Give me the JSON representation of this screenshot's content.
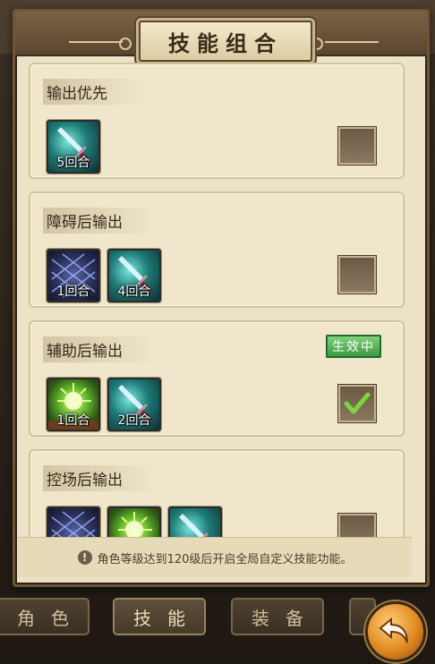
{
  "title": "技能组合",
  "combos": [
    {
      "title": "输出优先",
      "skills": [
        {
          "kind": "sword",
          "turns": "5回合"
        }
      ],
      "checked": false,
      "badge": ""
    },
    {
      "title": "障碍后输出",
      "skills": [
        {
          "kind": "net",
          "turns": "1回合"
        },
        {
          "kind": "sword",
          "turns": "4回合"
        }
      ],
      "checked": false,
      "badge": ""
    },
    {
      "title": "辅助后输出",
      "skills": [
        {
          "kind": "heal",
          "turns": "1回合"
        },
        {
          "kind": "sword",
          "turns": "2回合"
        }
      ],
      "checked": true,
      "badge": "生效中"
    },
    {
      "title": "控场后输出",
      "skills": [
        {
          "kind": "net",
          "turns": ""
        },
        {
          "kind": "heal",
          "turns": ""
        },
        {
          "kind": "sword",
          "turns": ""
        }
      ],
      "checked": false,
      "badge": ""
    }
  ],
  "notice": "角色等级达到120级后开启全局自定义技能功能。",
  "tabs": [
    "角色",
    "技能",
    "装备"
  ],
  "active_tab": "技能",
  "icons": {
    "notice": "info-icon",
    "back": "back-arrow-icon",
    "checked": "check-mark-icon"
  },
  "colors": {
    "badge": "#3d9a46",
    "check": "#7bd63a"
  }
}
